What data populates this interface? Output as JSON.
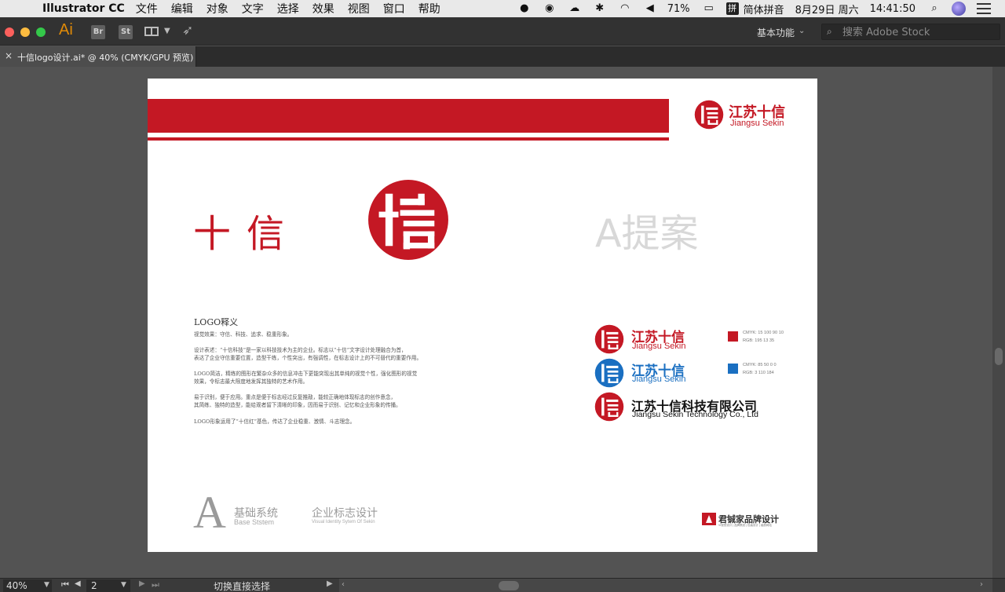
{
  "menubar": {
    "app_name": "Illustrator CC",
    "menus": [
      "文件",
      "编辑",
      "对象",
      "文字",
      "选择",
      "效果",
      "视图",
      "窗口",
      "帮助"
    ],
    "battery": "71%",
    "ime_badge": "拼",
    "ime_name": "简体拼音",
    "date": "8月29日 周六",
    "time": "14:41:50"
  },
  "toolbar": {
    "app_logo": "Ai",
    "bridge_label": "Br",
    "stock_label": "St",
    "workspace_label": "基本功能",
    "stock_search_placeholder": "搜索 Adobe Stock"
  },
  "document_tab": {
    "close_glyph": "×",
    "title": "十信logo设计.ai* @ 40% (CMYK/GPU 预览)"
  },
  "artboard": {
    "header_brand": {
      "cn": "江苏十信",
      "en": "Jiangsu Sekin"
    },
    "logo_wordmark": "十信",
    "proposal_label": "A提案",
    "explanation": {
      "title": "LOGO释义",
      "paragraphs": [
        "视觉效果：守信、科技、追求、稳重形象。",
        "设计表述：“十信科技”是一家以科技技术为主的企业。标志以“十信”文字设计处理融合为首，\n表达了企业守信重要位置，造型干练，个性突出，有强调性，在标志设计上的不可替代的重要作用。",
        "LOGO简洁，精练的图形在繁杂众多的信息冲击下更能突现出其单纯的视觉个性，强化图形的视觉\n效果，令标志最大限度地发挥其独特的艺术作用。",
        "易于识别，便于应用。重点是便于标志经过反复推敲，能较正确地体现标志的创作意念，\n其简练、独特的造型，能给观者留下清晰的印象，因而易于识别、记忆和企业形象的传播。",
        "LOGO形象运用了“十信红”基色，传达了企业稳重、激情、斗志理念。"
      ]
    },
    "variants": [
      {
        "cn": "江苏十信",
        "en": "Jiangsu Sekin",
        "color": "#c41824",
        "swatch_text": "CMYK: 15 100 90 10\nRGB: 195 13 35"
      },
      {
        "cn": "江苏十信",
        "en": "Jiangsu Sekin",
        "color": "#1a6fc1",
        "swatch_text": "CMYK: 85 50 0 0\nRGB: 3 110 184"
      },
      {
        "cn": "江苏十信科技有限公司",
        "en": "Jiangsu Sekin Technology Co., Ltd",
        "color": "#c41824"
      }
    ],
    "footer": {
      "letter": "A",
      "basic_cn": "基础系统",
      "basic_en": "Base Ststem",
      "vi_cn": "企业标志设计",
      "vi_en": "Visual Identity Sytem Of Sekin",
      "studio_name": "君铖家品牌设计",
      "studio_sub": "VI视觉设计 | 品牌策划 | 包装设计 | 画册网站"
    },
    "colors": {
      "brand_red": "#c41824",
      "brand_blue": "#1a6fc1"
    }
  },
  "statusbar": {
    "zoom": "40%",
    "page": "2",
    "tool_hint": "切换直接选择"
  }
}
